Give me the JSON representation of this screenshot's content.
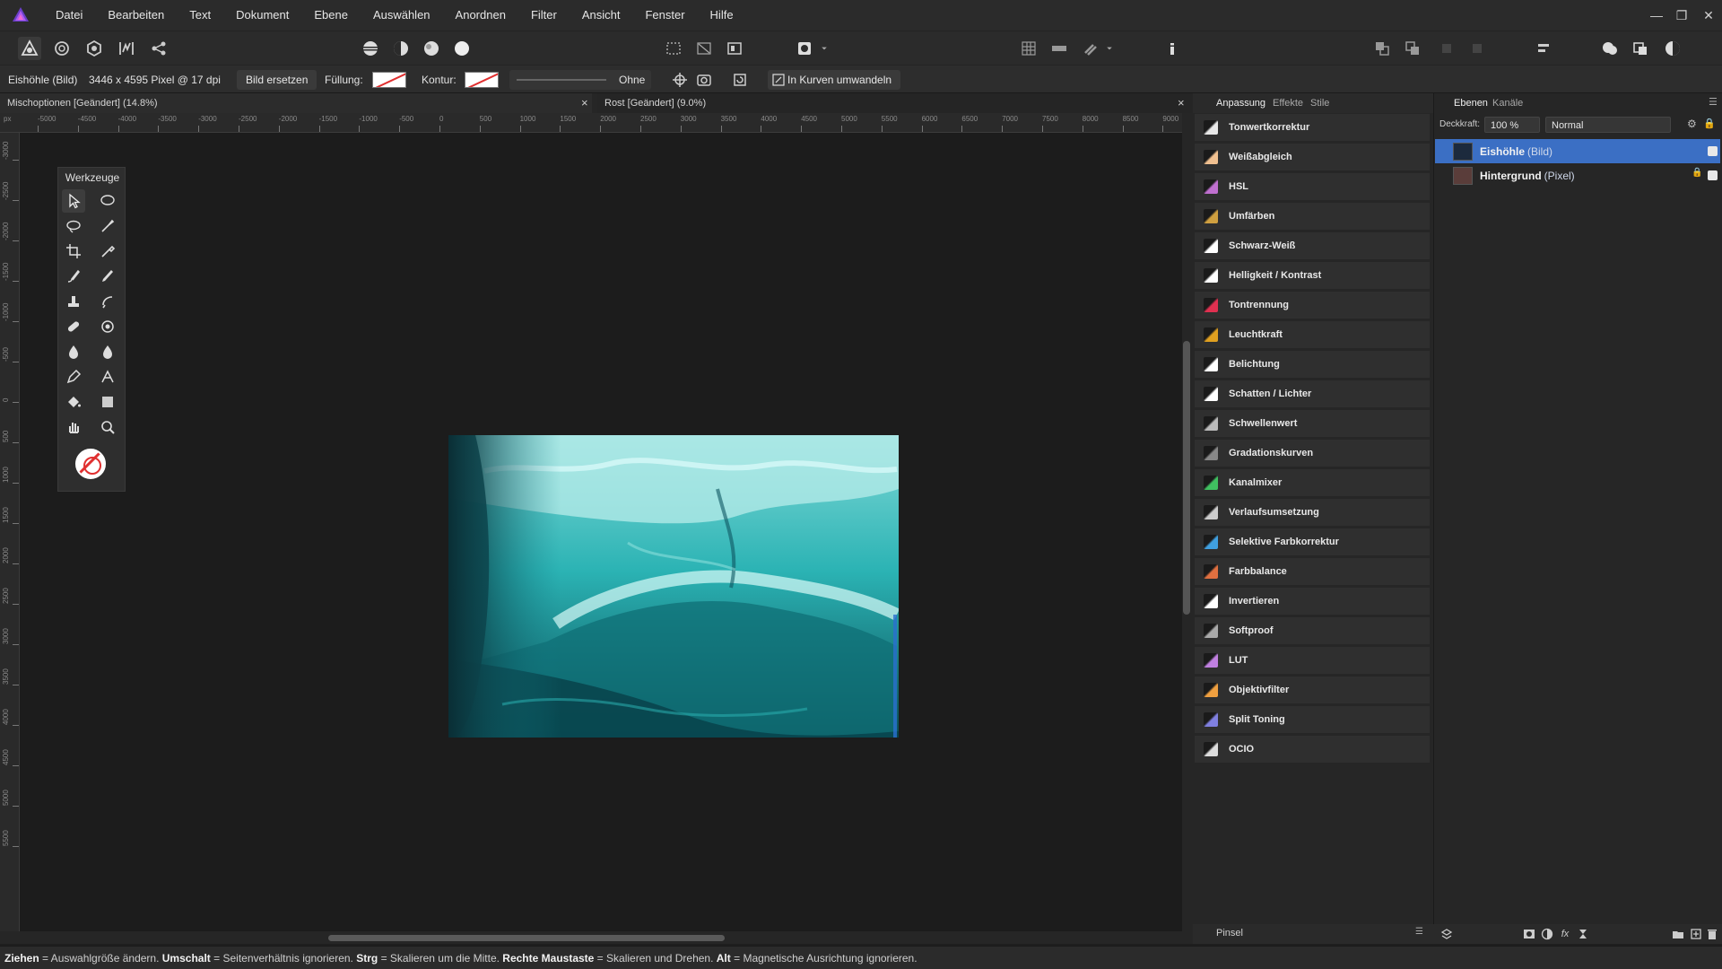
{
  "menubar": {
    "items": [
      "Datei",
      "Bearbeiten",
      "Text",
      "Dokument",
      "Ebene",
      "Auswählen",
      "Anordnen",
      "Filter",
      "Ansicht",
      "Fenster",
      "Hilfe"
    ],
    "window_controls": [
      "—",
      "❐",
      "✕"
    ]
  },
  "context": {
    "layer_label": "Eishöhle (Bild)",
    "dimensions": "3446 x 4595 Pixel @ 17 dpi",
    "replace_button": "Bild ersetzen",
    "fill_label": "Füllung:",
    "stroke_label": "Kontur:",
    "stroke_width": "Ohne",
    "convert_button": "In Kurven umwandeln"
  },
  "tabs": {
    "doc1": "Mischoptionen [Geändert] (14.8%)",
    "doc2": "Rost [Geändert] (9.0%)",
    "close": "×"
  },
  "ruler": {
    "top_ticks": [
      "-5000",
      "-4500",
      "-4000",
      "-3500",
      "-3000",
      "-2500",
      "-2000",
      "-1500",
      "-1000",
      "-500",
      "0",
      "500",
      "1000",
      "1500",
      "2000",
      "2500",
      "3000",
      "3500",
      "4000",
      "4500",
      "5000",
      "5500",
      "6000",
      "6500",
      "7000",
      "7500",
      "8000",
      "8500",
      "9000"
    ],
    "left_ticks": [
      "-3000",
      "-2500",
      "-2000",
      "-1500",
      "-1000",
      "-500",
      "0",
      "500",
      "1000",
      "1500",
      "2000",
      "2500",
      "3000",
      "3500",
      "4000",
      "4500",
      "5000",
      "5500"
    ],
    "unit": "px"
  },
  "tools": {
    "title": "Werkzeuge"
  },
  "adjustments": {
    "tabs": [
      "Anpassung",
      "Effekte",
      "Stile"
    ],
    "items": [
      {
        "label": "Tonwertkorrektur",
        "color": "#e8e8e8"
      },
      {
        "label": "Weißabgleich",
        "color": "#f0c090"
      },
      {
        "label": "HSL",
        "color": "#c070d0"
      },
      {
        "label": "Umfärben",
        "color": "#d0a040"
      },
      {
        "label": "Schwarz-Weiß",
        "color": "#ffffff"
      },
      {
        "label": "Helligkeit / Kontrast",
        "color": "#ffffff"
      },
      {
        "label": "Tontrennung",
        "color": "#e03050"
      },
      {
        "label": "Leuchtkraft",
        "color": "#e0a020"
      },
      {
        "label": "Belichtung",
        "color": "#ffffff"
      },
      {
        "label": "Schatten / Lichter",
        "color": "#ffffff"
      },
      {
        "label": "Schwellenwert",
        "color": "#bbbbbb"
      },
      {
        "label": "Gradationskurven",
        "color": "#888888"
      },
      {
        "label": "Kanalmixer",
        "color": "#40c060"
      },
      {
        "label": "Verlaufsumsetzung",
        "color": "#cccccc"
      },
      {
        "label": "Selektive Farbkorrektur",
        "color": "#40a0e0"
      },
      {
        "label": "Farbbalance",
        "color": "#e07040"
      },
      {
        "label": "Invertieren",
        "color": "#ffffff"
      },
      {
        "label": "Softproof",
        "color": "#aaaaaa"
      },
      {
        "label": "LUT",
        "color": "#c080e0"
      },
      {
        "label": "Objektivfilter",
        "color": "#f0a040"
      },
      {
        "label": "Split Toning",
        "color": "#8080e0"
      },
      {
        "label": "OCIO",
        "color": "#dddddd"
      }
    ],
    "footer_label": "Pinsel"
  },
  "layers": {
    "tabs": [
      "Ebenen",
      "Kanäle"
    ],
    "opacity_label": "Deckkraft:",
    "opacity_value": "100 %",
    "blend_mode": "Normal",
    "rows": [
      {
        "name": "Eishöhle",
        "type": "(Bild)"
      },
      {
        "name": "Hintergrund",
        "type": "(Pixel)"
      }
    ]
  },
  "status": {
    "k1": "Ziehen",
    "t1": " = Auswahlgröße ändern. ",
    "k2": "Umschalt",
    "t2": " = Seitenverhältnis ignorieren. ",
    "k3": "Strg",
    "t3": " = Skalieren um die Mitte. ",
    "k4": "Rechte Maustaste",
    "t4": " = Skalieren und Drehen. ",
    "k5": "Alt",
    "t5": " = Magnetische Ausrichtung ignorieren."
  },
  "colors": {
    "accent": "#4a7fd4",
    "selected_layer": "#3b6fc4",
    "image_teal": "#1fa6a8"
  }
}
